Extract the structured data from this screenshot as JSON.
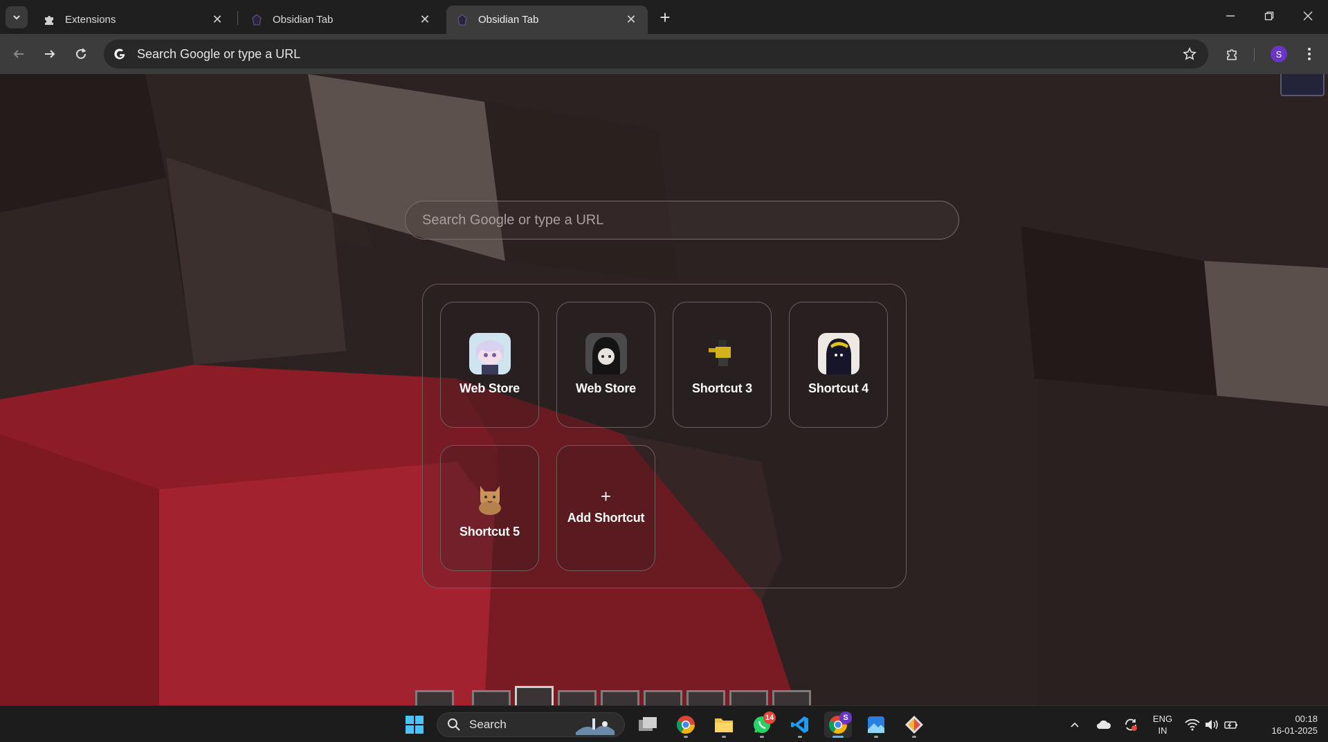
{
  "tabs": [
    {
      "title": "Extensions",
      "icon": "puzzle-icon",
      "active": false
    },
    {
      "title": "Obsidian Tab",
      "icon": "obsidian-icon",
      "active": false
    },
    {
      "title": "Obsidian Tab",
      "icon": "obsidian-icon",
      "active": true
    }
  ],
  "toolbar": {
    "omnibox_text": "Search Google or type a URL",
    "profile_initial": "S"
  },
  "newtab": {
    "search_placeholder": "Search Google or type a URL",
    "shortcuts": [
      {
        "label": "Web Store",
        "icon": "anime-girl-avatar"
      },
      {
        "label": "Web Store",
        "icon": "dark-character-avatar"
      },
      {
        "label": "Shortcut 3",
        "icon": "yellow-figure-avatar"
      },
      {
        "label": "Shortcut 4",
        "icon": "hooded-figure-avatar"
      },
      {
        "label": "Shortcut 5",
        "icon": "cat-avatar"
      }
    ],
    "add_shortcut": {
      "symbol": "+",
      "label": "Add Shortcut"
    }
  },
  "taskbar": {
    "search_label": "Search",
    "whatsapp_badge": "14",
    "chrome_profile_badge": "S",
    "language": {
      "line1": "ENG",
      "line2": "IN"
    },
    "time": "00:18",
    "date": "16-01-2025"
  },
  "colors": {
    "accent": "#6a35c7",
    "tab_bar": "#1f1f1f",
    "toolbar": "#3c3c3c",
    "wallpaper_red": "#9b1f2a"
  }
}
